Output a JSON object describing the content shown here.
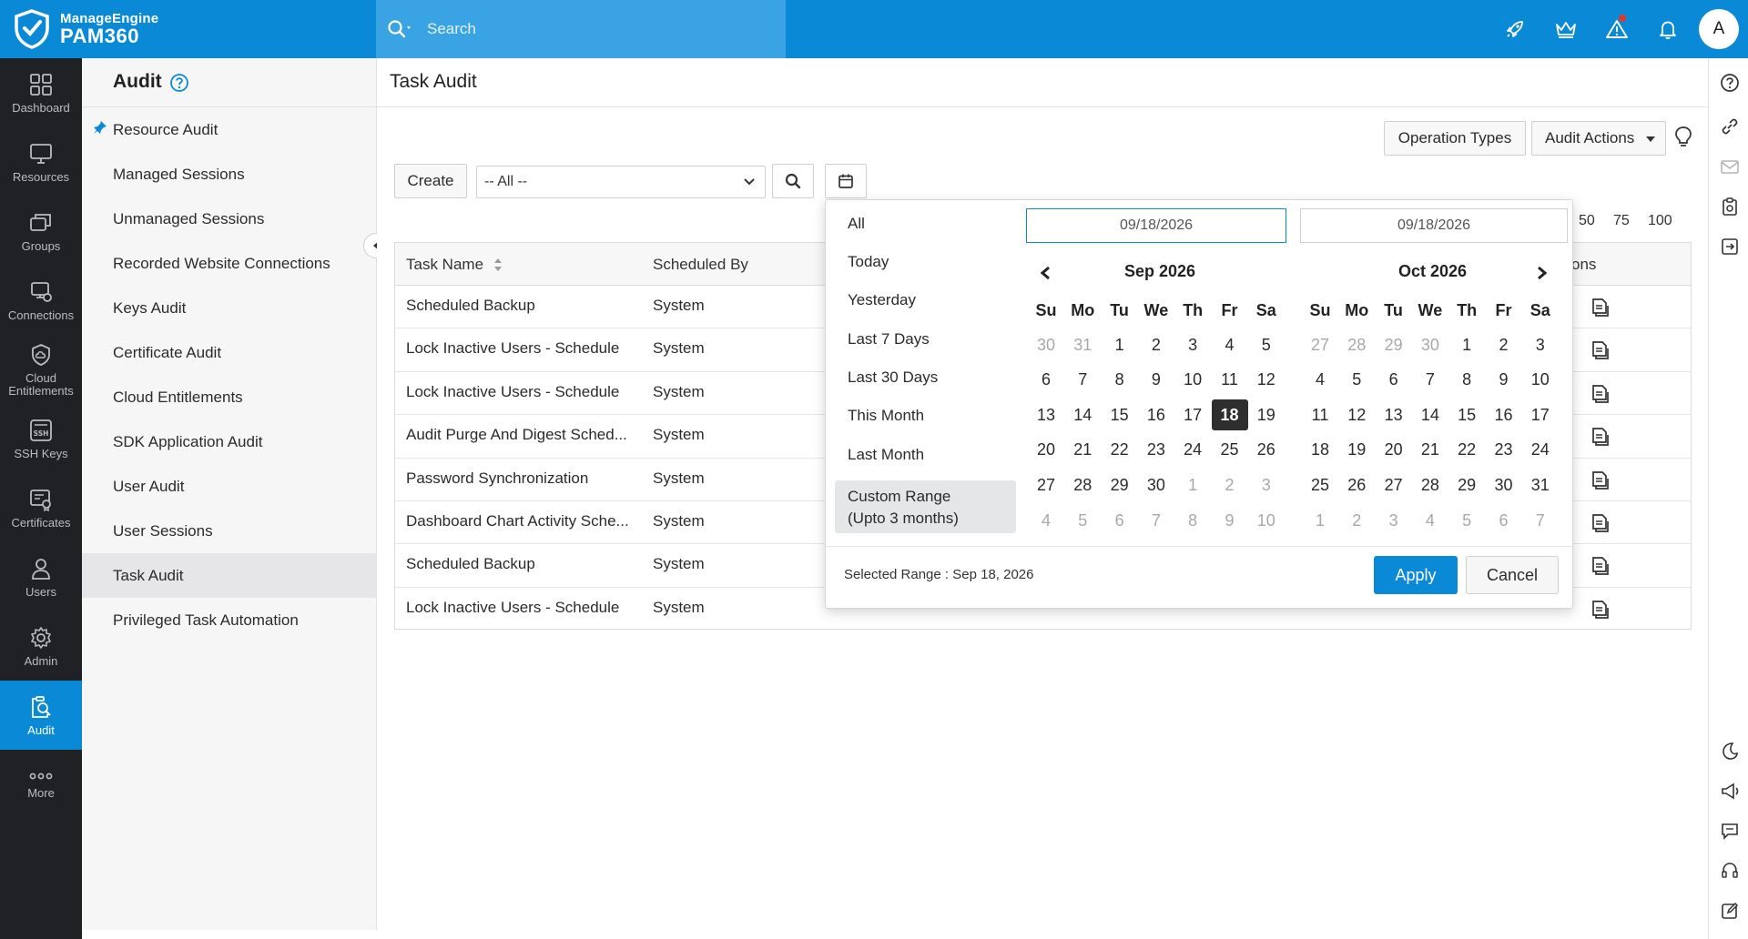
{
  "brand": {
    "line1": "ManageEngine",
    "line2": "PAM360"
  },
  "search": {
    "placeholder": "Search"
  },
  "user": {
    "initial": "A"
  },
  "leftnav": {
    "items": [
      {
        "label": "Dashboard",
        "icon": "dashboard-icon"
      },
      {
        "label": "Resources",
        "icon": "monitor-icon"
      },
      {
        "label": "Groups",
        "icon": "groups-icon"
      },
      {
        "label": "Connections",
        "icon": "connections-icon"
      },
      {
        "label": "Cloud Entitlements",
        "icon": "cloud-shield-icon"
      },
      {
        "label": "SSH Keys",
        "icon": "ssh-icon"
      },
      {
        "label": "Certificates",
        "icon": "certificate-icon"
      },
      {
        "label": "Users",
        "icon": "user-icon"
      },
      {
        "label": "Admin",
        "icon": "gear-icon"
      },
      {
        "label": "Audit",
        "icon": "audit-icon"
      },
      {
        "label": "More",
        "icon": "more-icon"
      }
    ]
  },
  "subnav": {
    "title": "Audit",
    "items": [
      "Resource Audit",
      "Managed Sessions",
      "Unmanaged Sessions",
      "Recorded Website Connections",
      "Keys Audit",
      "Certificate Audit",
      "Cloud Entitlements",
      "SDK Application Audit",
      "User Audit",
      "User Sessions",
      "Task Audit",
      "Privileged Task Automation"
    ]
  },
  "main": {
    "title": "Task Audit",
    "operation_types": "Operation Types",
    "audit_actions": "Audit Actions",
    "create": "Create",
    "filter_value": "-- All --",
    "pager": [
      "50",
      "75",
      "100"
    ]
  },
  "table": {
    "headers": {
      "task_name": "Task Name",
      "scheduled_by": "Scheduled By",
      "actions": "ons"
    },
    "rows": [
      {
        "task": "Scheduled Backup",
        "by": "System"
      },
      {
        "task": "Lock Inactive Users - Schedule",
        "by": "System"
      },
      {
        "task": "Lock Inactive Users - Schedule",
        "by": "System"
      },
      {
        "task": "Audit Purge And Digest Sched...",
        "by": "System"
      },
      {
        "task": "Password Synchronization",
        "by": "System"
      },
      {
        "task": "Dashboard Chart Activity Sche...",
        "by": "System"
      },
      {
        "task": "Scheduled Backup",
        "by": "System"
      },
      {
        "task": "Lock Inactive Users - Schedule",
        "by": "System"
      }
    ]
  },
  "datepicker": {
    "presets": [
      "All",
      "Today",
      "Yesterday",
      "Last 7 Days",
      "Last 30 Days",
      "This Month",
      "Last Month"
    ],
    "custom_line1": "Custom Range",
    "custom_line2": "(Upto 3 months)",
    "start_date": "09/18/2026",
    "end_date": "09/18/2026",
    "weekdays": [
      "Su",
      "Mo",
      "Tu",
      "We",
      "Th",
      "Fr",
      "Sa"
    ],
    "left": {
      "month": "Sep 2026",
      "days": [
        "30",
        "31",
        "1",
        "2",
        "3",
        "4",
        "5",
        "6",
        "7",
        "8",
        "9",
        "10",
        "11",
        "12",
        "13",
        "14",
        "15",
        "16",
        "17",
        "18",
        "19",
        "20",
        "21",
        "22",
        "23",
        "24",
        "25",
        "26",
        "27",
        "28",
        "29",
        "30",
        "1",
        "2",
        "3",
        "4",
        "5",
        "6",
        "7",
        "8",
        "9",
        "10"
      ],
      "muted": [
        0,
        1,
        32,
        33,
        34,
        35,
        36,
        37,
        38,
        39,
        40,
        41
      ],
      "selected": 19
    },
    "right": {
      "month": "Oct 2026",
      "days": [
        "27",
        "28",
        "29",
        "30",
        "1",
        "2",
        "3",
        "4",
        "5",
        "6",
        "7",
        "8",
        "9",
        "10",
        "11",
        "12",
        "13",
        "14",
        "15",
        "16",
        "17",
        "18",
        "19",
        "20",
        "21",
        "22",
        "23",
        "24",
        "25",
        "26",
        "27",
        "28",
        "29",
        "30",
        "31",
        "1",
        "2",
        "3",
        "4",
        "5",
        "6",
        "7"
      ],
      "muted": [
        0,
        1,
        2,
        3,
        35,
        36,
        37,
        38,
        39,
        40,
        41
      ]
    },
    "selected_range": "Selected Range : Sep 18, 2026",
    "apply": "Apply",
    "cancel": "Cancel"
  },
  "colors": {
    "primary": "#0a8ad6",
    "nav_bg": "#1f2125",
    "today_bg": "#2e2e2e"
  }
}
